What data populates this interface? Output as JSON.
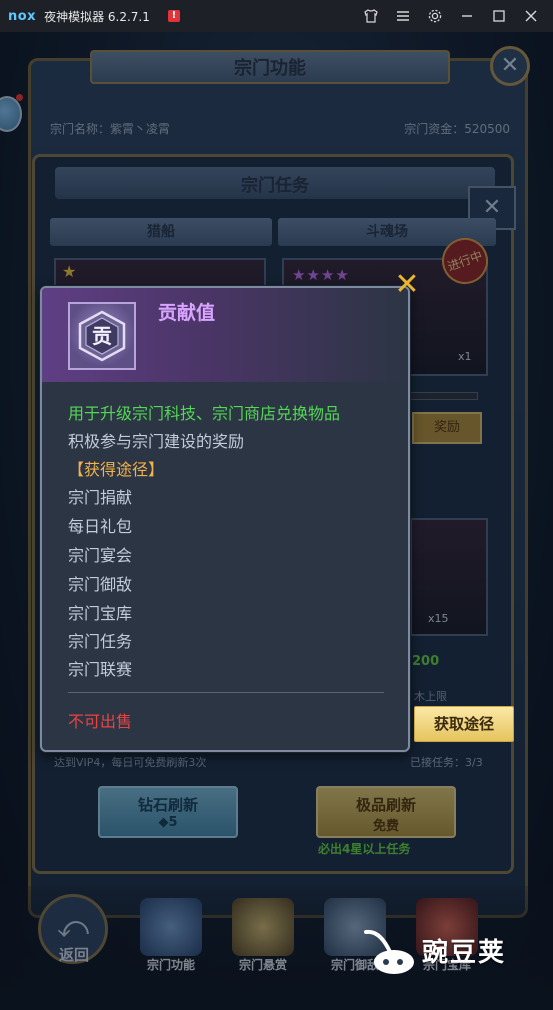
{
  "emulator": {
    "logo_text": "nox",
    "app_title": "夜神模拟器 6.2.7.1",
    "alert_badge": "!",
    "icons": [
      "shirt-icon",
      "menu-icon",
      "gear-icon",
      "minimize-icon",
      "maximize-icon",
      "close-icon"
    ]
  },
  "background": {
    "panel_title": "宗门功能",
    "sect_name": "宗门名称：紫霄丶凌霄",
    "sect_funds": "宗门资金：520500",
    "task_title": "宗门任务",
    "col_left": "猎船",
    "col_right": "斗魂场",
    "ongoing_badge": "进行中",
    "reward_button": "奖励",
    "x1_label": "x1",
    "x15_label": "x15",
    "green_value": "200",
    "daily_note": "达到VIP4，每日可免费刷新3次",
    "remaining_note": "已接任务：3/3",
    "right_label": "木上限",
    "refresh_diamond_label": "钻石刷新",
    "refresh_diamond_cost": "5",
    "refresh_quality_label": "极品刷新",
    "refresh_quality_sub": "免费",
    "quality_note": "必出4星以上任务",
    "nav": {
      "back_label": "返回",
      "items": [
        "宗门功能",
        "宗门悬赏",
        "宗门御敌",
        "宗门宝库"
      ]
    }
  },
  "tooltip": {
    "title": "贡献值",
    "icon_glyph": "贡",
    "lines": [
      {
        "text": "用于升级宗门科技、宗门商店兑换物品",
        "style": "green"
      },
      {
        "text": "积极参与宗门建设的奖励",
        "style": "gray"
      },
      {
        "text": "【获得途径】",
        "style": "orange"
      },
      {
        "text": "宗门捐献",
        "style": "gray"
      },
      {
        "text": "每日礼包",
        "style": "gray"
      },
      {
        "text": "宗门宴会",
        "style": "gray"
      },
      {
        "text": "宗门御敌",
        "style": "gray"
      },
      {
        "text": "宗门宝库",
        "style": "gray"
      },
      {
        "text": "宗门任务",
        "style": "gray"
      },
      {
        "text": "宗门联赛",
        "style": "gray"
      }
    ],
    "footer": "不可出售",
    "get_way_button": "获取途径"
  },
  "watermark": {
    "text": "豌豆荚"
  },
  "colors": {
    "tooltip_title": "#d9a4ff",
    "green": "#54d656",
    "orange": "#f0b24a",
    "red": "#e84444",
    "button_gold": "#e6c45e"
  }
}
